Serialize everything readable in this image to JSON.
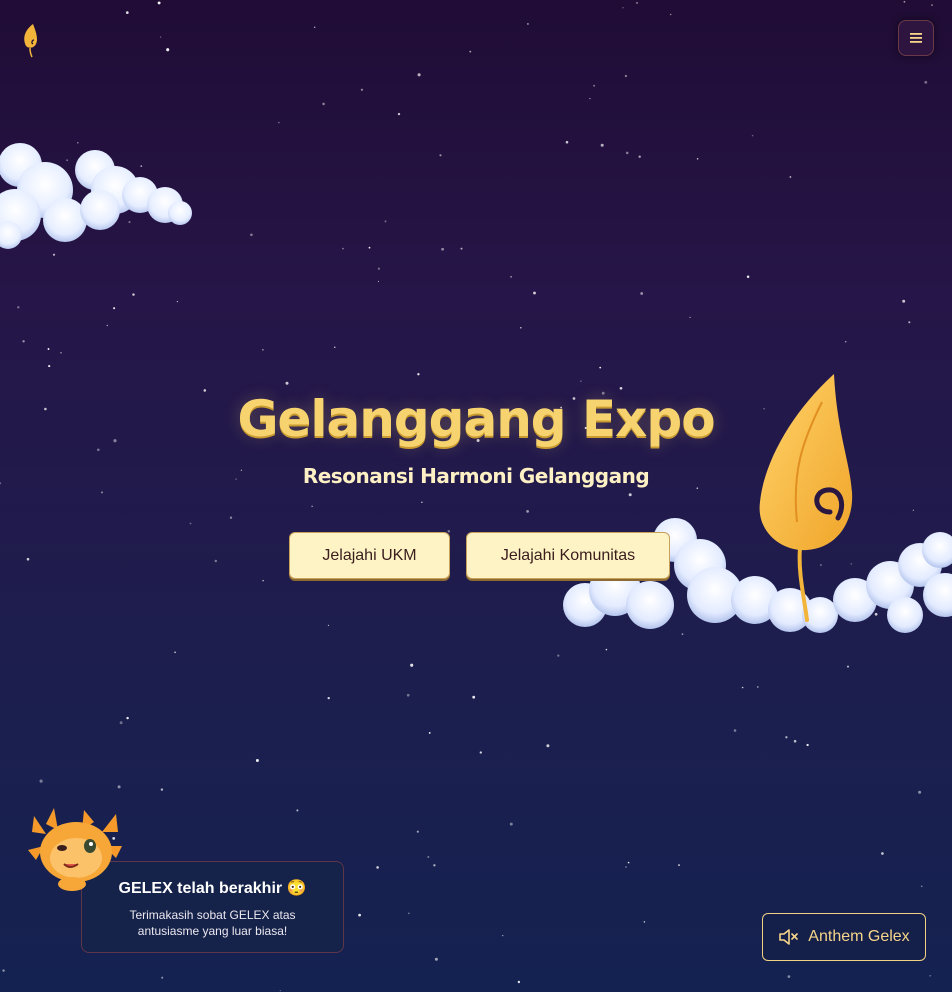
{
  "header": {
    "logo_icon": "feather-logo-icon",
    "menu_icon": "hamburger-menu-icon"
  },
  "hero": {
    "title": "Gelanggang Expo",
    "subtitle": "Resonansi Harmoni Gelanggang",
    "buttons": [
      {
        "label": "Jelajahi UKM"
      },
      {
        "label": "Jelajahi Komunitas"
      }
    ]
  },
  "toast": {
    "title": "GELEX telah berakhir 😳",
    "message": "Terimakasih sobat GELEX atas antusiasme yang luar biasa!"
  },
  "audio": {
    "label": "Anthem Gelex",
    "icon": "speaker-muted-icon"
  },
  "colors": {
    "background_top": "#200c35",
    "background_bottom": "#142251",
    "accent_gold": "#f6d36e",
    "button_bg": "#fef3c4"
  }
}
